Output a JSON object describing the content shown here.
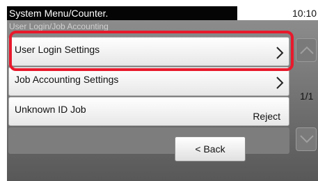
{
  "header": {
    "title": "System Menu/Counter.",
    "time": "10:10"
  },
  "breadcrumb": "User Login/Job Accounting",
  "menu": {
    "items": [
      {
        "label": "User Login Settings",
        "value": ""
      },
      {
        "label": "Job Accounting Settings",
        "value": ""
      },
      {
        "label": "Unknown ID Job",
        "value": "Reject"
      }
    ]
  },
  "pager": {
    "indicator": "1/1"
  },
  "footer": {
    "back_label": "< Back"
  },
  "colors": {
    "highlight": "#e8192c",
    "title_bar": "#050505",
    "panel": "#6a6a6a"
  },
  "icons": {
    "row_arrow": "chevron-right-icon",
    "scroll_up": "chevron-up-icon",
    "scroll_down": "chevron-down-icon"
  }
}
